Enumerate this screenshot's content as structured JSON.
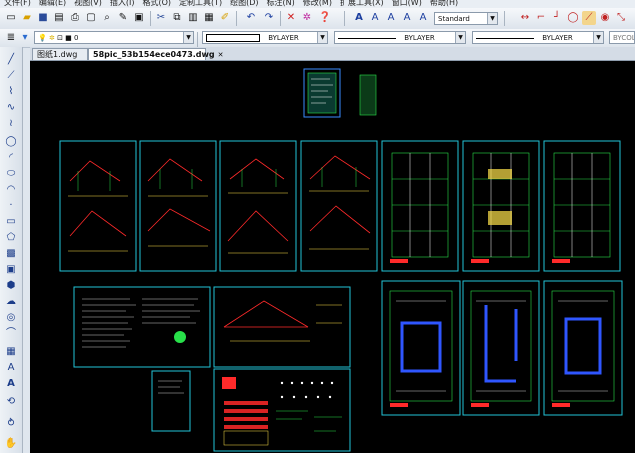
{
  "menu": [
    "文件(F)",
    "编辑(E)",
    "视图(V)",
    "插入(I)",
    "格式(O)",
    "定制工具(T)",
    "绘图(D)",
    "标注(N)",
    "修改(M)",
    "扩展工具(X)",
    "窗口(W)",
    "帮助(H)"
  ],
  "toolbar": {
    "text_style": "Standard",
    "layer": "0",
    "color": "BYLAYER",
    "linetype": "BYLAYER",
    "lineweight": "BYLAYER",
    "plotstyle": "BYCOLOR"
  },
  "tabs": [
    {
      "label": "图纸1.dwg"
    },
    {
      "label": "58pic_53b154ece0473.dwg"
    }
  ],
  "colors": {
    "canvas": "#000000",
    "frame": "#22c4d8",
    "red": "#ff2a2a",
    "green": "#28e04a",
    "yellow": "#ffe34a",
    "blue": "#2f56ff",
    "white": "#ffffff"
  }
}
